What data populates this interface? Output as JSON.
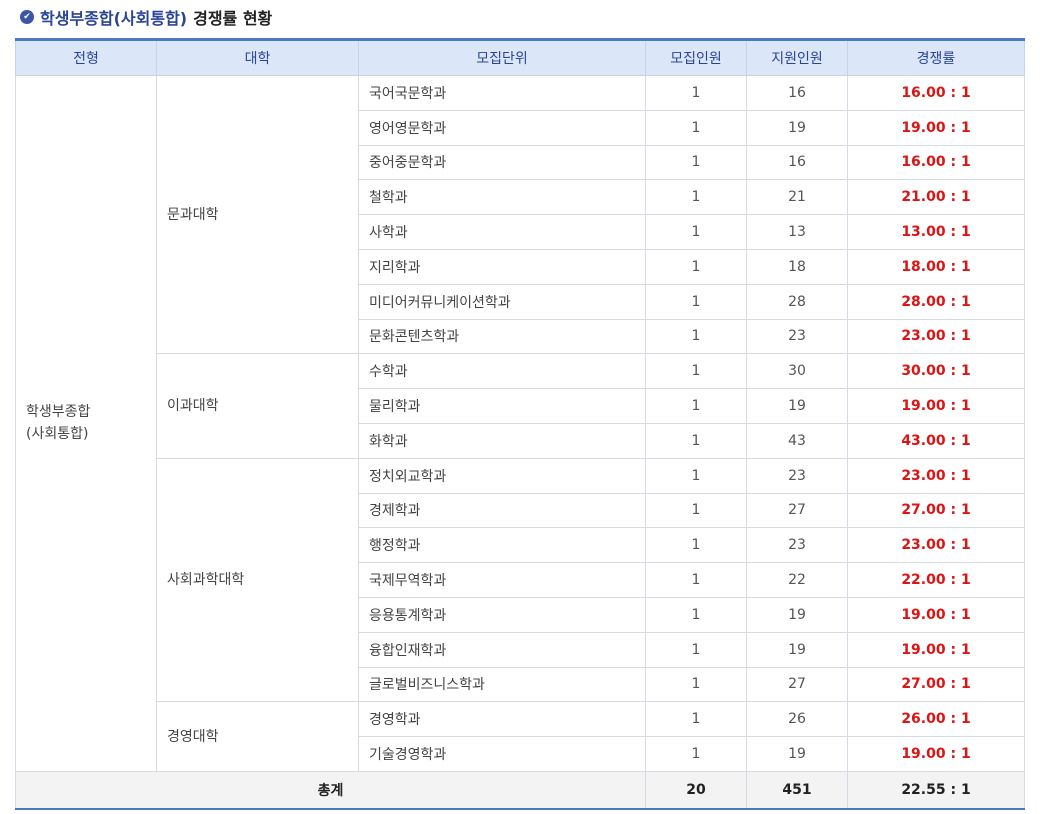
{
  "header": {
    "title_main": "학생부종합(사회통합)",
    "title_sub": "경쟁률 현황",
    "icon": "check-circle-icon"
  },
  "columns": [
    "전형",
    "대학",
    "모집단위",
    "모집인원",
    "지원인원",
    "경쟁률"
  ],
  "type": {
    "line1": "학생부종합",
    "line2": "(사회통합)"
  },
  "colleges": [
    {
      "name": "문과대학",
      "units": [
        {
          "name": "국어국문학과",
          "quota": "1",
          "applicants": "16",
          "rate": "16.00 : 1"
        },
        {
          "name": "영어영문학과",
          "quota": "1",
          "applicants": "19",
          "rate": "19.00 : 1"
        },
        {
          "name": "중어중문학과",
          "quota": "1",
          "applicants": "16",
          "rate": "16.00 : 1"
        },
        {
          "name": "철학과",
          "quota": "1",
          "applicants": "21",
          "rate": "21.00 : 1"
        },
        {
          "name": "사학과",
          "quota": "1",
          "applicants": "13",
          "rate": "13.00 : 1"
        },
        {
          "name": "지리학과",
          "quota": "1",
          "applicants": "18",
          "rate": "18.00 : 1"
        },
        {
          "name": "미디어커뮤니케이션학과",
          "quota": "1",
          "applicants": "28",
          "rate": "28.00 : 1"
        },
        {
          "name": "문화콘텐츠학과",
          "quota": "1",
          "applicants": "23",
          "rate": "23.00 : 1"
        }
      ]
    },
    {
      "name": "이과대학",
      "units": [
        {
          "name": "수학과",
          "quota": "1",
          "applicants": "30",
          "rate": "30.00 : 1"
        },
        {
          "name": "물리학과",
          "quota": "1",
          "applicants": "19",
          "rate": "19.00 : 1"
        },
        {
          "name": "화학과",
          "quota": "1",
          "applicants": "43",
          "rate": "43.00 : 1"
        }
      ]
    },
    {
      "name": "사회과학대학",
      "units": [
        {
          "name": "정치외교학과",
          "quota": "1",
          "applicants": "23",
          "rate": "23.00 : 1"
        },
        {
          "name": "경제학과",
          "quota": "1",
          "applicants": "27",
          "rate": "27.00 : 1"
        },
        {
          "name": "행정학과",
          "quota": "1",
          "applicants": "23",
          "rate": "23.00 : 1"
        },
        {
          "name": "국제무역학과",
          "quota": "1",
          "applicants": "22",
          "rate": "22.00 : 1"
        },
        {
          "name": "응용통계학과",
          "quota": "1",
          "applicants": "19",
          "rate": "19.00 : 1"
        },
        {
          "name": "융합인재학과",
          "quota": "1",
          "applicants": "19",
          "rate": "19.00 : 1"
        },
        {
          "name": "글로벌비즈니스학과",
          "quota": "1",
          "applicants": "27",
          "rate": "27.00 : 1"
        }
      ]
    },
    {
      "name": "경영대학",
      "units": [
        {
          "name": "경영학과",
          "quota": "1",
          "applicants": "26",
          "rate": "26.00 : 1"
        },
        {
          "name": "기술경영학과",
          "quota": "1",
          "applicants": "19",
          "rate": "19.00 : 1"
        }
      ]
    }
  ],
  "total": {
    "label": "총계",
    "quota": "20",
    "applicants": "451",
    "rate": "22.55 : 1"
  },
  "colors": {
    "accent": "#2b4596",
    "rate": "#dd1414",
    "header_bg": "#dbe7f8"
  }
}
